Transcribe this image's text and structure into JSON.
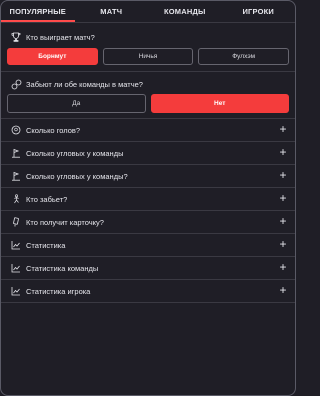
{
  "tabs": [
    {
      "label": "ПОПУЛЯРНЫЕ",
      "active": true
    },
    {
      "label": "МАТЧ",
      "active": false
    },
    {
      "label": "КОМАНДЫ",
      "active": false
    },
    {
      "label": "ИГРОКИ",
      "active": false
    }
  ],
  "accent_color": "#f43c3c",
  "winner_question": {
    "icon": "trophy-icon",
    "title": "Кто выиграет матч?",
    "options": [
      {
        "label": "Борнмут",
        "selected": true
      },
      {
        "label": "Ничья",
        "selected": false
      },
      {
        "label": "Фулхэм",
        "selected": false
      }
    ]
  },
  "both_score_question": {
    "icon": "ball-pair-icon",
    "title": "Забьют ли обе команды в матче?",
    "options": [
      {
        "label": "Да",
        "selected": false
      },
      {
        "label": "Нет",
        "selected": true
      }
    ]
  },
  "accordion": [
    {
      "icon": "ball-icon",
      "label": "Сколько голов?"
    },
    {
      "icon": "corner-flag-icon",
      "label": "Сколько угловых у команды"
    },
    {
      "icon": "corner-flag-icon",
      "label": "Сколько угловых у команды?"
    },
    {
      "icon": "person-kick-icon",
      "label": "Кто забьет?"
    },
    {
      "icon": "card-icon",
      "label": "Кто получит карточку?"
    },
    {
      "icon": "chart-icon",
      "label": "Статистика"
    },
    {
      "icon": "chart-icon",
      "label": "Статистика команды"
    },
    {
      "icon": "chart-icon",
      "label": "Статистика игрока"
    }
  ],
  "expand_symbol": "+"
}
